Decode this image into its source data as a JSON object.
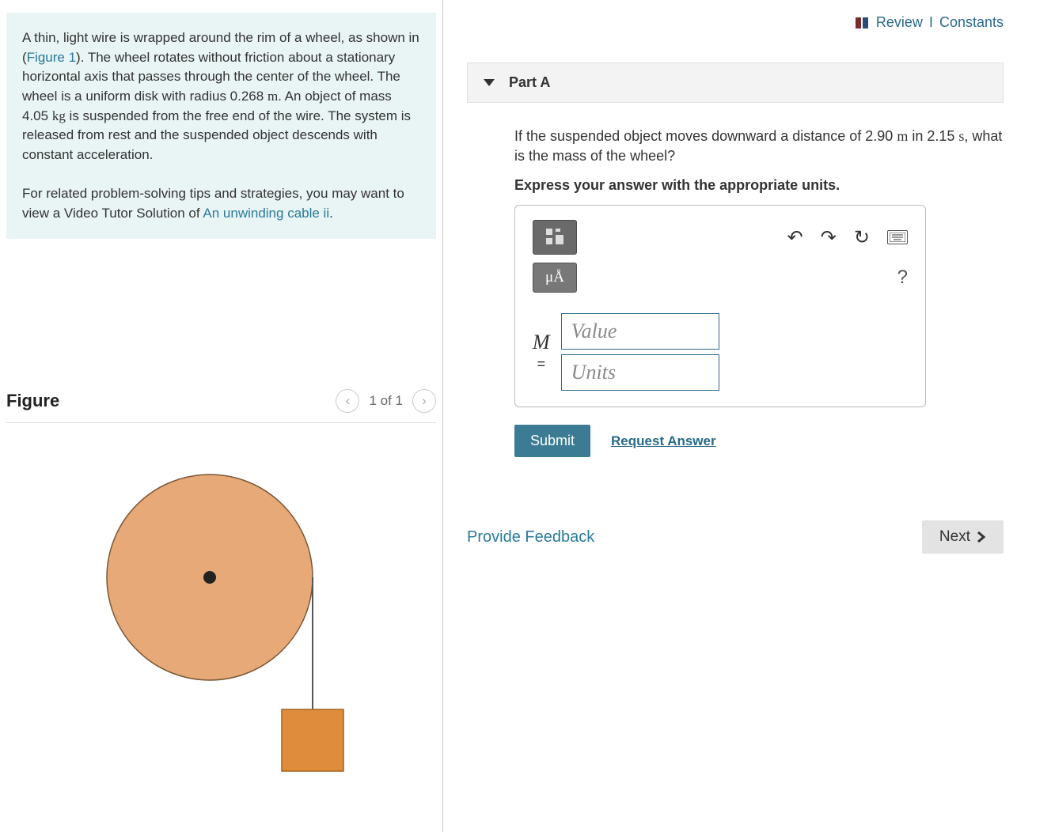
{
  "problem": {
    "text_before_figlink": "A thin, light wire is wrapped around the rim of a wheel, as shown in (",
    "figlink": "Figure 1",
    "text_after_figlink": "). The wheel rotates without friction about a stationary horizontal axis that passes through the center of the wheel. The wheel is a uniform disk with radius 0.268 ",
    "unit_m": "m",
    "text_mid": ". An object of mass 4.05 ",
    "unit_kg": "kg",
    "text_end": " is suspended from the free end of the wire. The system is released from rest and the suspended object descends with constant acceleration.",
    "hint_before": "For related problem-solving tips and strategies, you may want to view a Video Tutor Solution of ",
    "hint_link": "An unwinding cable ii",
    "hint_after": "."
  },
  "figure": {
    "title": "Figure",
    "counter": "1 of 1"
  },
  "top": {
    "review": "Review",
    "sep": " I ",
    "constants": "Constants"
  },
  "partA": {
    "label": "Part A",
    "question_before": "If the suspended object moves downward a distance of 2.90 ",
    "q_unit_m": "m",
    "q_mid": " in 2.15 ",
    "q_unit_s": "s",
    "q_end": ", what is the mass of the wheel?",
    "instruction": "Express your answer with the appropriate units.",
    "mu_label": "μÅ",
    "var": "M",
    "eq": "=",
    "value_placeholder": "Value",
    "units_placeholder": "Units",
    "submit": "Submit",
    "request": "Request Answer"
  },
  "footer": {
    "feedback": "Provide Feedback",
    "next": "Next"
  }
}
